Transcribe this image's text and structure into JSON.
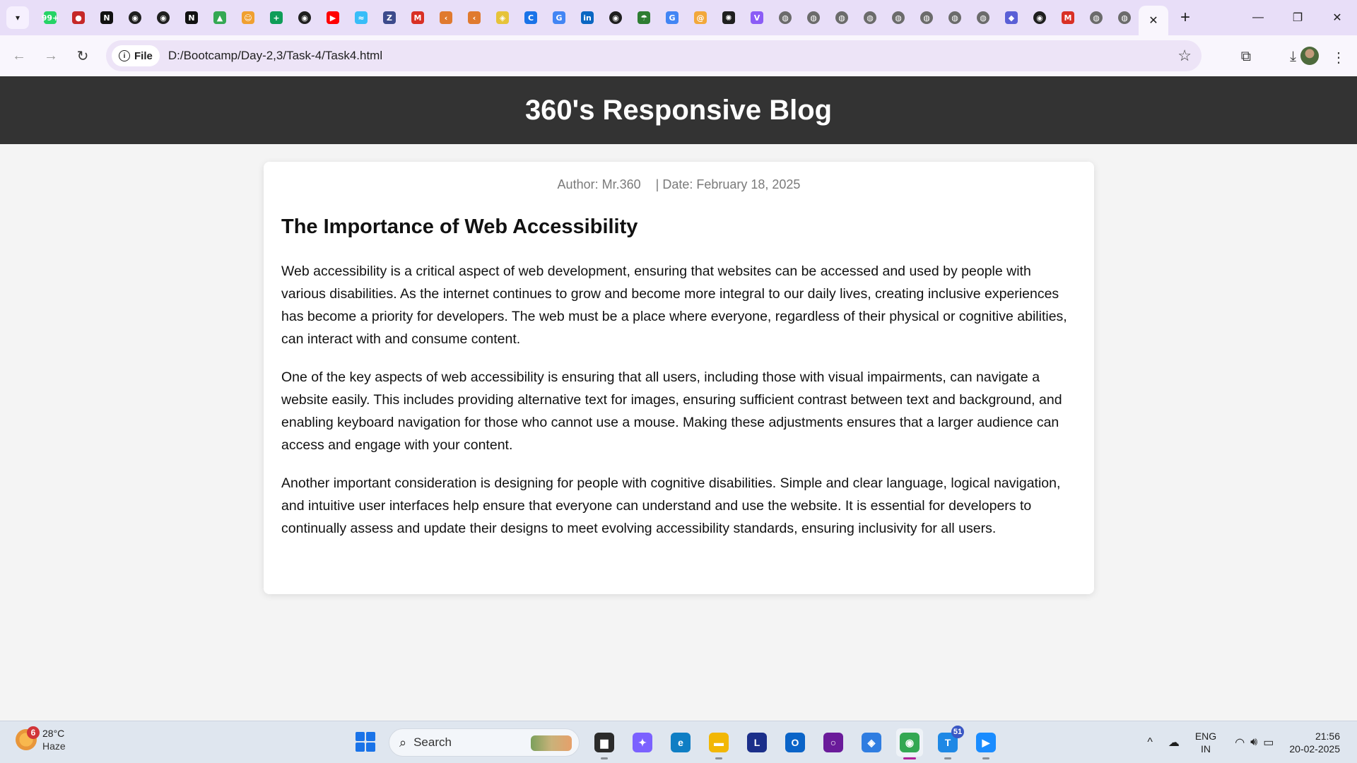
{
  "browser": {
    "tabs": [
      {
        "icon": "whatsapp-icon",
        "glyph": "99+",
        "color": "#25d366"
      },
      {
        "icon": "record-icon",
        "glyph": "●",
        "color": "#c62828"
      },
      {
        "icon": "notion-icon",
        "glyph": "N",
        "color": "#111111"
      },
      {
        "icon": "github-icon",
        "glyph": "◉",
        "color": "#1f1f1f"
      },
      {
        "icon": "github-icon",
        "glyph": "◉",
        "color": "#1f1f1f"
      },
      {
        "icon": "notion-icon",
        "glyph": "N",
        "color": "#111111"
      },
      {
        "icon": "google-drive-icon",
        "glyph": "▲",
        "color": "#34a853"
      },
      {
        "icon": "emoji-icon",
        "glyph": "☺",
        "color": "#f0a030"
      },
      {
        "icon": "google-sheets-icon",
        "glyph": "+",
        "color": "#0f9d58"
      },
      {
        "icon": "github-icon",
        "glyph": "◉",
        "color": "#1f1f1f"
      },
      {
        "icon": "youtube-icon",
        "glyph": "▶",
        "color": "#ff0000"
      },
      {
        "icon": "tailwind-icon",
        "glyph": "≈",
        "color": "#38bdf8"
      },
      {
        "icon": "zeo-icon",
        "glyph": "Z",
        "color": "#3c4a8c"
      },
      {
        "icon": "gmail-icon",
        "glyph": "M",
        "color": "#d93025"
      },
      {
        "icon": "codeium-icon",
        "glyph": "‹",
        "color": "#e07a2f"
      },
      {
        "icon": "codeium-icon",
        "glyph": "‹",
        "color": "#e07a2f"
      },
      {
        "icon": "learning-icon",
        "glyph": "◈",
        "color": "#e6c33a"
      },
      {
        "icon": "refresh-g-icon",
        "glyph": "C",
        "color": "#1a73e8"
      },
      {
        "icon": "google-icon",
        "glyph": "G",
        "color": "#4285f4"
      },
      {
        "icon": "linkedin-icon",
        "glyph": "in",
        "color": "#0a66c2"
      },
      {
        "icon": "github-icon",
        "glyph": "◉",
        "color": "#1f1f1f"
      },
      {
        "icon": "umbrella-icon",
        "glyph": "☂",
        "color": "#2e7d32"
      },
      {
        "icon": "google-icon",
        "glyph": "G",
        "color": "#4285f4"
      },
      {
        "icon": "spiral-icon",
        "glyph": "@",
        "color": "#f2a83b"
      },
      {
        "icon": "openai-icon",
        "glyph": "✺",
        "color": "#1f1f1f"
      },
      {
        "icon": "vite-icon",
        "glyph": "V",
        "color": "#8b5cf6"
      },
      {
        "icon": "globe-icon",
        "glyph": "◍",
        "color": "#6b6b6b"
      },
      {
        "icon": "globe-icon",
        "glyph": "◍",
        "color": "#6b6b6b"
      },
      {
        "icon": "globe-icon",
        "glyph": "◍",
        "color": "#6b6b6b"
      },
      {
        "icon": "globe-icon",
        "glyph": "◍",
        "color": "#6b6b6b"
      },
      {
        "icon": "globe-icon",
        "glyph": "◍",
        "color": "#6b6b6b"
      },
      {
        "icon": "globe-icon",
        "glyph": "◍",
        "color": "#6b6b6b"
      },
      {
        "icon": "globe-icon",
        "glyph": "◍",
        "color": "#6b6b6b"
      },
      {
        "icon": "globe-icon",
        "glyph": "◍",
        "color": "#6b6b6b"
      },
      {
        "icon": "chat-app-icon",
        "glyph": "◆",
        "color": "#5a5fd6"
      },
      {
        "icon": "github-icon",
        "glyph": "◉",
        "color": "#1f1f1f"
      },
      {
        "icon": "gmail-icon",
        "glyph": "M",
        "color": "#d93025"
      },
      {
        "icon": "globe-icon",
        "glyph": "◍",
        "color": "#6b6b6b"
      },
      {
        "icon": "globe-icon",
        "glyph": "◍",
        "color": "#6b6b6b"
      }
    ],
    "active_tab_close": "✕",
    "new_tab": "+",
    "window": {
      "minimize": "—",
      "restore": "❐",
      "close": "✕"
    },
    "back": "←",
    "forward": "→",
    "reload": "↻",
    "site_chip": "File",
    "url": "D:/Bootcamp/Day-2,3/Task-4/Task4.html",
    "bookmark_star": "☆",
    "extensions": "⧉",
    "download": "⤓",
    "menu": "⋮"
  },
  "page": {
    "header_title": "360's Responsive Blog",
    "author": "Author: Mr.360",
    "date": "| Date: February 18, 2025",
    "post_title": "The Importance of Web Accessibility",
    "paragraphs": [
      "Web accessibility is a critical aspect of web development, ensuring that websites can be accessed and used by people with various disabilities. As the internet continues to grow and become more integral to our daily lives, creating inclusive experiences has become a priority for developers. The web must be a place where everyone, regardless of their physical or cognitive abilities, can interact with and consume content.",
      "One of the key aspects of web accessibility is ensuring that all users, including those with visual impairments, can navigate a website easily. This includes providing alternative text for images, ensuring sufficient contrast between text and background, and enabling keyboard navigation for those who cannot use a mouse. Making these adjustments ensures that a larger audience can access and engage with your content.",
      "Another important consideration is designing for people with cognitive disabilities. Simple and clear language, logical navigation, and intuitive user interfaces help ensure that everyone can understand and use the website. It is essential for developers to continually assess and update their designs to meet evolving accessibility standards, ensuring inclusivity for all users."
    ]
  },
  "taskbar": {
    "weather_badge": "6",
    "temperature": "28°C",
    "condition": "Haze",
    "search_label": "Search",
    "apps": [
      {
        "name": "file-manager-icon",
        "glyph": "▆",
        "color": "#2b2b2b"
      },
      {
        "name": "copilot-icon",
        "glyph": "✦",
        "color": "#7b61ff"
      },
      {
        "name": "edge-icon",
        "glyph": "e",
        "color": "#0f7ec4"
      },
      {
        "name": "file-explorer-icon",
        "glyph": "▬",
        "color": "#f2b705"
      },
      {
        "name": "l-app-icon",
        "glyph": "L",
        "color": "#1b2f8a"
      },
      {
        "name": "outlook-icon",
        "glyph": "O",
        "color": "#0a64c8"
      },
      {
        "name": "cortana-icon",
        "glyph": "○",
        "color": "#6a1b9a"
      },
      {
        "name": "microsoft-365-icon",
        "glyph": "◈",
        "color": "#2f7de1"
      },
      {
        "name": "chrome-icon",
        "glyph": "◉",
        "color": "#34a853"
      },
      {
        "name": "teams-icon",
        "glyph": "T",
        "color": "#1e88e5"
      },
      {
        "name": "zoom-icon",
        "glyph": "▶",
        "color": "#1a8cff"
      }
    ],
    "teams_count": "51",
    "active_app": 8,
    "chevron": "^",
    "language": "ENG",
    "region": "IN",
    "time": "21:56",
    "date": "20-02-2025"
  }
}
